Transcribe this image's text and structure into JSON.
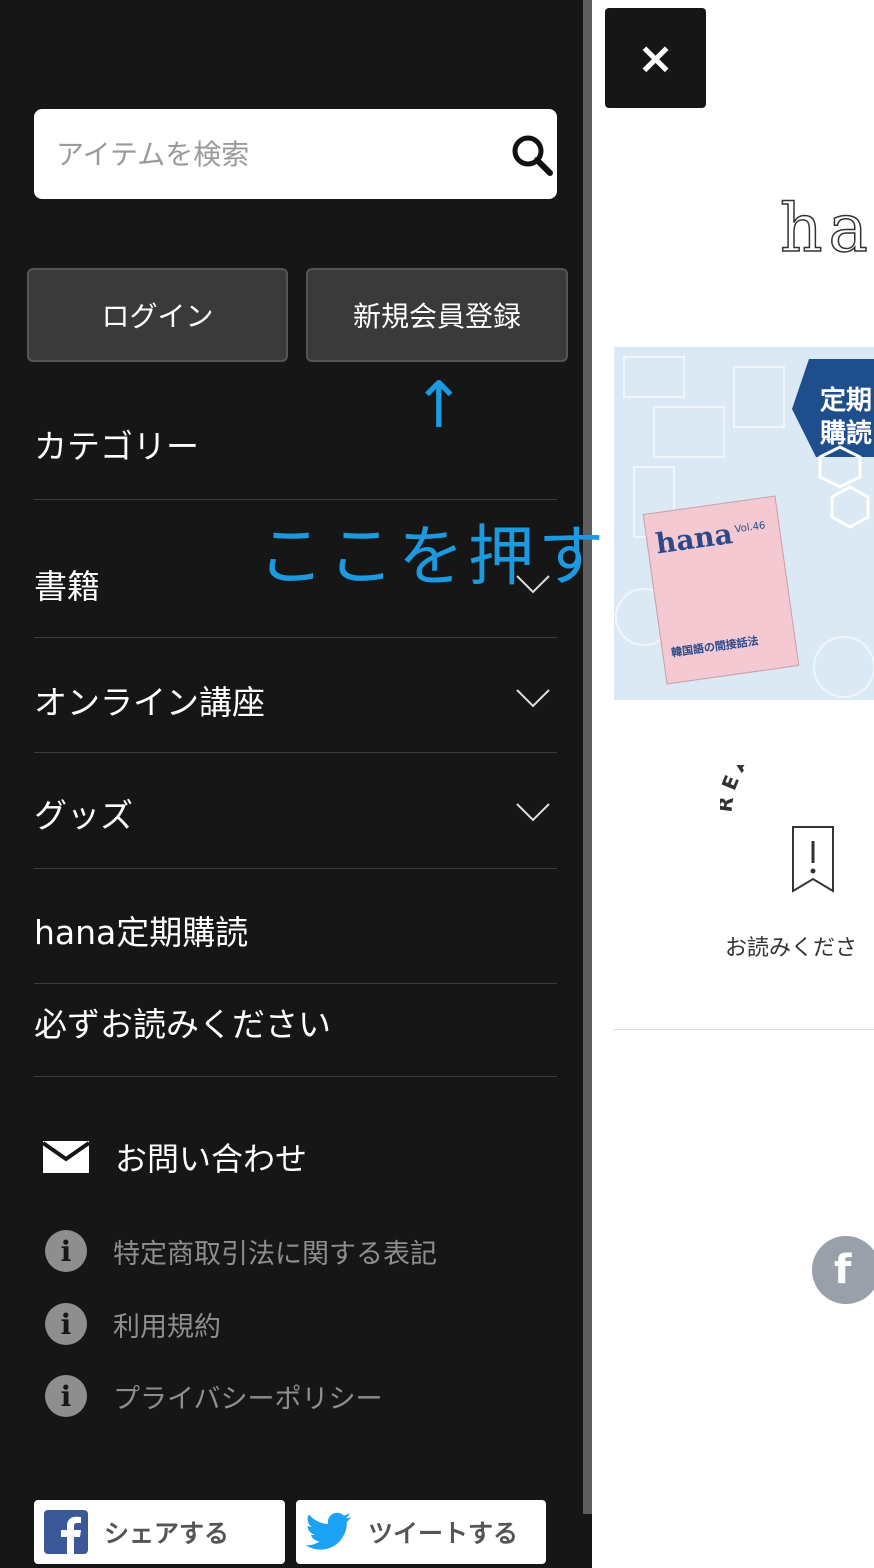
{
  "drawer": {
    "search": {
      "placeholder": "アイテムを検索",
      "icon": "search-icon"
    },
    "login_label": "ログイン",
    "register_label": "新規会員登録",
    "menu": {
      "category_heading": "カテゴリー",
      "items": [
        {
          "label": "書籍",
          "expandable": true
        },
        {
          "label": "オンライン講座",
          "expandable": true
        },
        {
          "label": "グッズ",
          "expandable": true
        },
        {
          "label": "hana定期購読",
          "expandable": false
        },
        {
          "label": "必ずお読みください",
          "expandable": false
        }
      ]
    },
    "contact_label": "お問い合わせ",
    "info_links": [
      {
        "label": "特定商取引法に関する表記"
      },
      {
        "label": "利用規約"
      },
      {
        "label": "プライバシーポリシー"
      }
    ],
    "share": {
      "facebook_label": "シェアする",
      "twitter_label": "ツイートする"
    }
  },
  "annotation": {
    "arrow": "↑",
    "text": "ここを押す"
  },
  "page": {
    "close_label": "×",
    "logo_text": "ha",
    "banner": {
      "badge_text": "定期\n購読",
      "magazine_title": "hana",
      "magazine_vol": "Vol.46",
      "magazine_subtitle": "韓国語の間接話法"
    },
    "readme_arc": "READ M",
    "readme_label": "お読みくださ",
    "facebook_glyph": "f"
  },
  "colors": {
    "drawer_bg": "#161616",
    "annotation": "#1b9ae0",
    "facebook": "#3b5998",
    "twitter": "#1da1f2"
  }
}
